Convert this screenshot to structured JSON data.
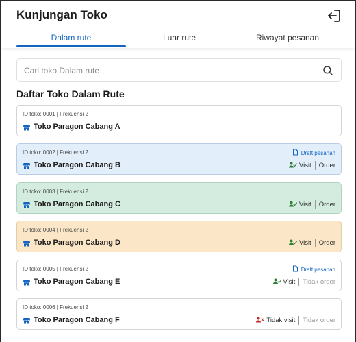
{
  "header": {
    "title": "Kunjungan Toko",
    "logout_icon": "logout-icon"
  },
  "tabs": [
    {
      "label": "Dalam rute",
      "active": true
    },
    {
      "label": "Luar rute",
      "active": false
    },
    {
      "label": "Riwayat pesanan",
      "active": false
    }
  ],
  "search": {
    "placeholder": "Cari toko Dalam rute",
    "value": "",
    "icon": "search-icon"
  },
  "section_title": "Daftar Toko Dalam Rute",
  "colors": {
    "accent": "#1565c0",
    "card_blue": "#e3eefb",
    "card_green": "#d4ecdf",
    "card_yellow": "#fbe7c7",
    "visit_green": "#2e7d32",
    "not_visit_red": "#c62828",
    "store_icon": "#1565c0"
  },
  "stores": [
    {
      "meta": "ID toko: 0001 | Frekuensi 2",
      "name": "Toko Paragon Cabang A",
      "variant": "white",
      "draft": "",
      "visit": "",
      "order": ""
    },
    {
      "meta": "ID toko: 0002 | Frekuensi 2",
      "name": "Toko Paragon Cabang B",
      "variant": "blue",
      "draft": "Draft pesanan",
      "visit": "Visit",
      "order": "Order"
    },
    {
      "meta": "ID toko: 0003 | Frekuensi 2",
      "name": "Toko Paragon Cabang C",
      "variant": "green",
      "draft": "",
      "visit": "Visit",
      "order": "Order"
    },
    {
      "meta": "ID toko: 0004 | Frekuensi 2",
      "name": "Toko Paragon Cabang D",
      "variant": "yellow",
      "draft": "",
      "visit": "Visit",
      "order": "Order"
    },
    {
      "meta": "ID toko: 0005 | Frekuensi 2",
      "name": "Toko Paragon Cabang E",
      "variant": "white",
      "draft": "Draft pesanan",
      "visit": "Visit",
      "order": "Tidak order"
    },
    {
      "meta": "ID toko: 0006 | Frekuensi 2",
      "name": "Toko Paragon Cabang F",
      "variant": "white",
      "draft": "",
      "visit": "Tidak visit",
      "order": "Tidak order"
    }
  ]
}
